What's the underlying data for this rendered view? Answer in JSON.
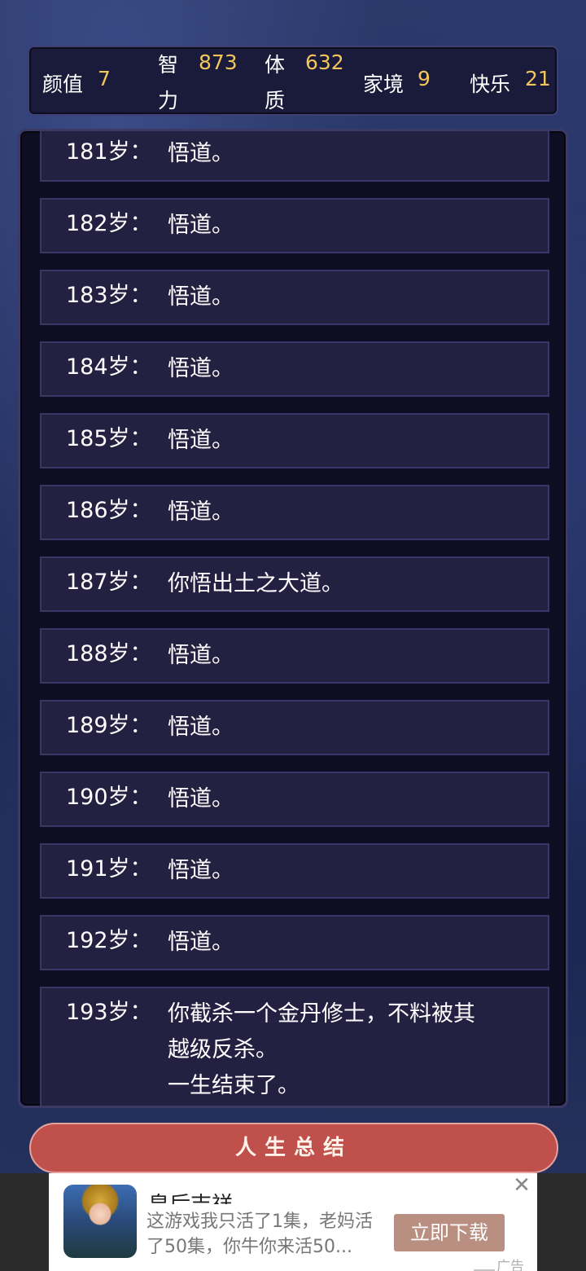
{
  "stats": {
    "appearance": {
      "label": "颜值",
      "value": "7"
    },
    "intelligence": {
      "label": "智力",
      "value": "873"
    },
    "constitution": {
      "label": "体质",
      "value": "632"
    },
    "family": {
      "label": "家境",
      "value": "9"
    },
    "happiness": {
      "label": "快乐",
      "value": "21"
    }
  },
  "events": [
    {
      "age": "181岁：",
      "text": [
        "悟道。"
      ]
    },
    {
      "age": "182岁：",
      "text": [
        "悟道。"
      ]
    },
    {
      "age": "183岁：",
      "text": [
        "悟道。"
      ]
    },
    {
      "age": "184岁：",
      "text": [
        "悟道。"
      ]
    },
    {
      "age": "185岁：",
      "text": [
        "悟道。"
      ]
    },
    {
      "age": "186岁：",
      "text": [
        "悟道。"
      ]
    },
    {
      "age": "187岁：",
      "text": [
        "你悟出土之大道。"
      ]
    },
    {
      "age": "188岁：",
      "text": [
        "悟道。"
      ]
    },
    {
      "age": "189岁：",
      "text": [
        "悟道。"
      ]
    },
    {
      "age": "190岁：",
      "text": [
        "悟道。"
      ]
    },
    {
      "age": "191岁：",
      "text": [
        "悟道。"
      ]
    },
    {
      "age": "192岁：",
      "text": [
        "悟道。"
      ]
    },
    {
      "age": "193岁：",
      "text": [
        "你截杀一个金丹修士，不料被其",
        "越级反杀。",
        "一生结束了。"
      ]
    }
  ],
  "summary_button": "人生总结",
  "ad": {
    "title": "皇后吉祥",
    "description": "这游戏我只活了1集，老妈活了50集，你牛你来活50...",
    "cta": "立即下载",
    "close": "✕",
    "tag": "广告"
  }
}
